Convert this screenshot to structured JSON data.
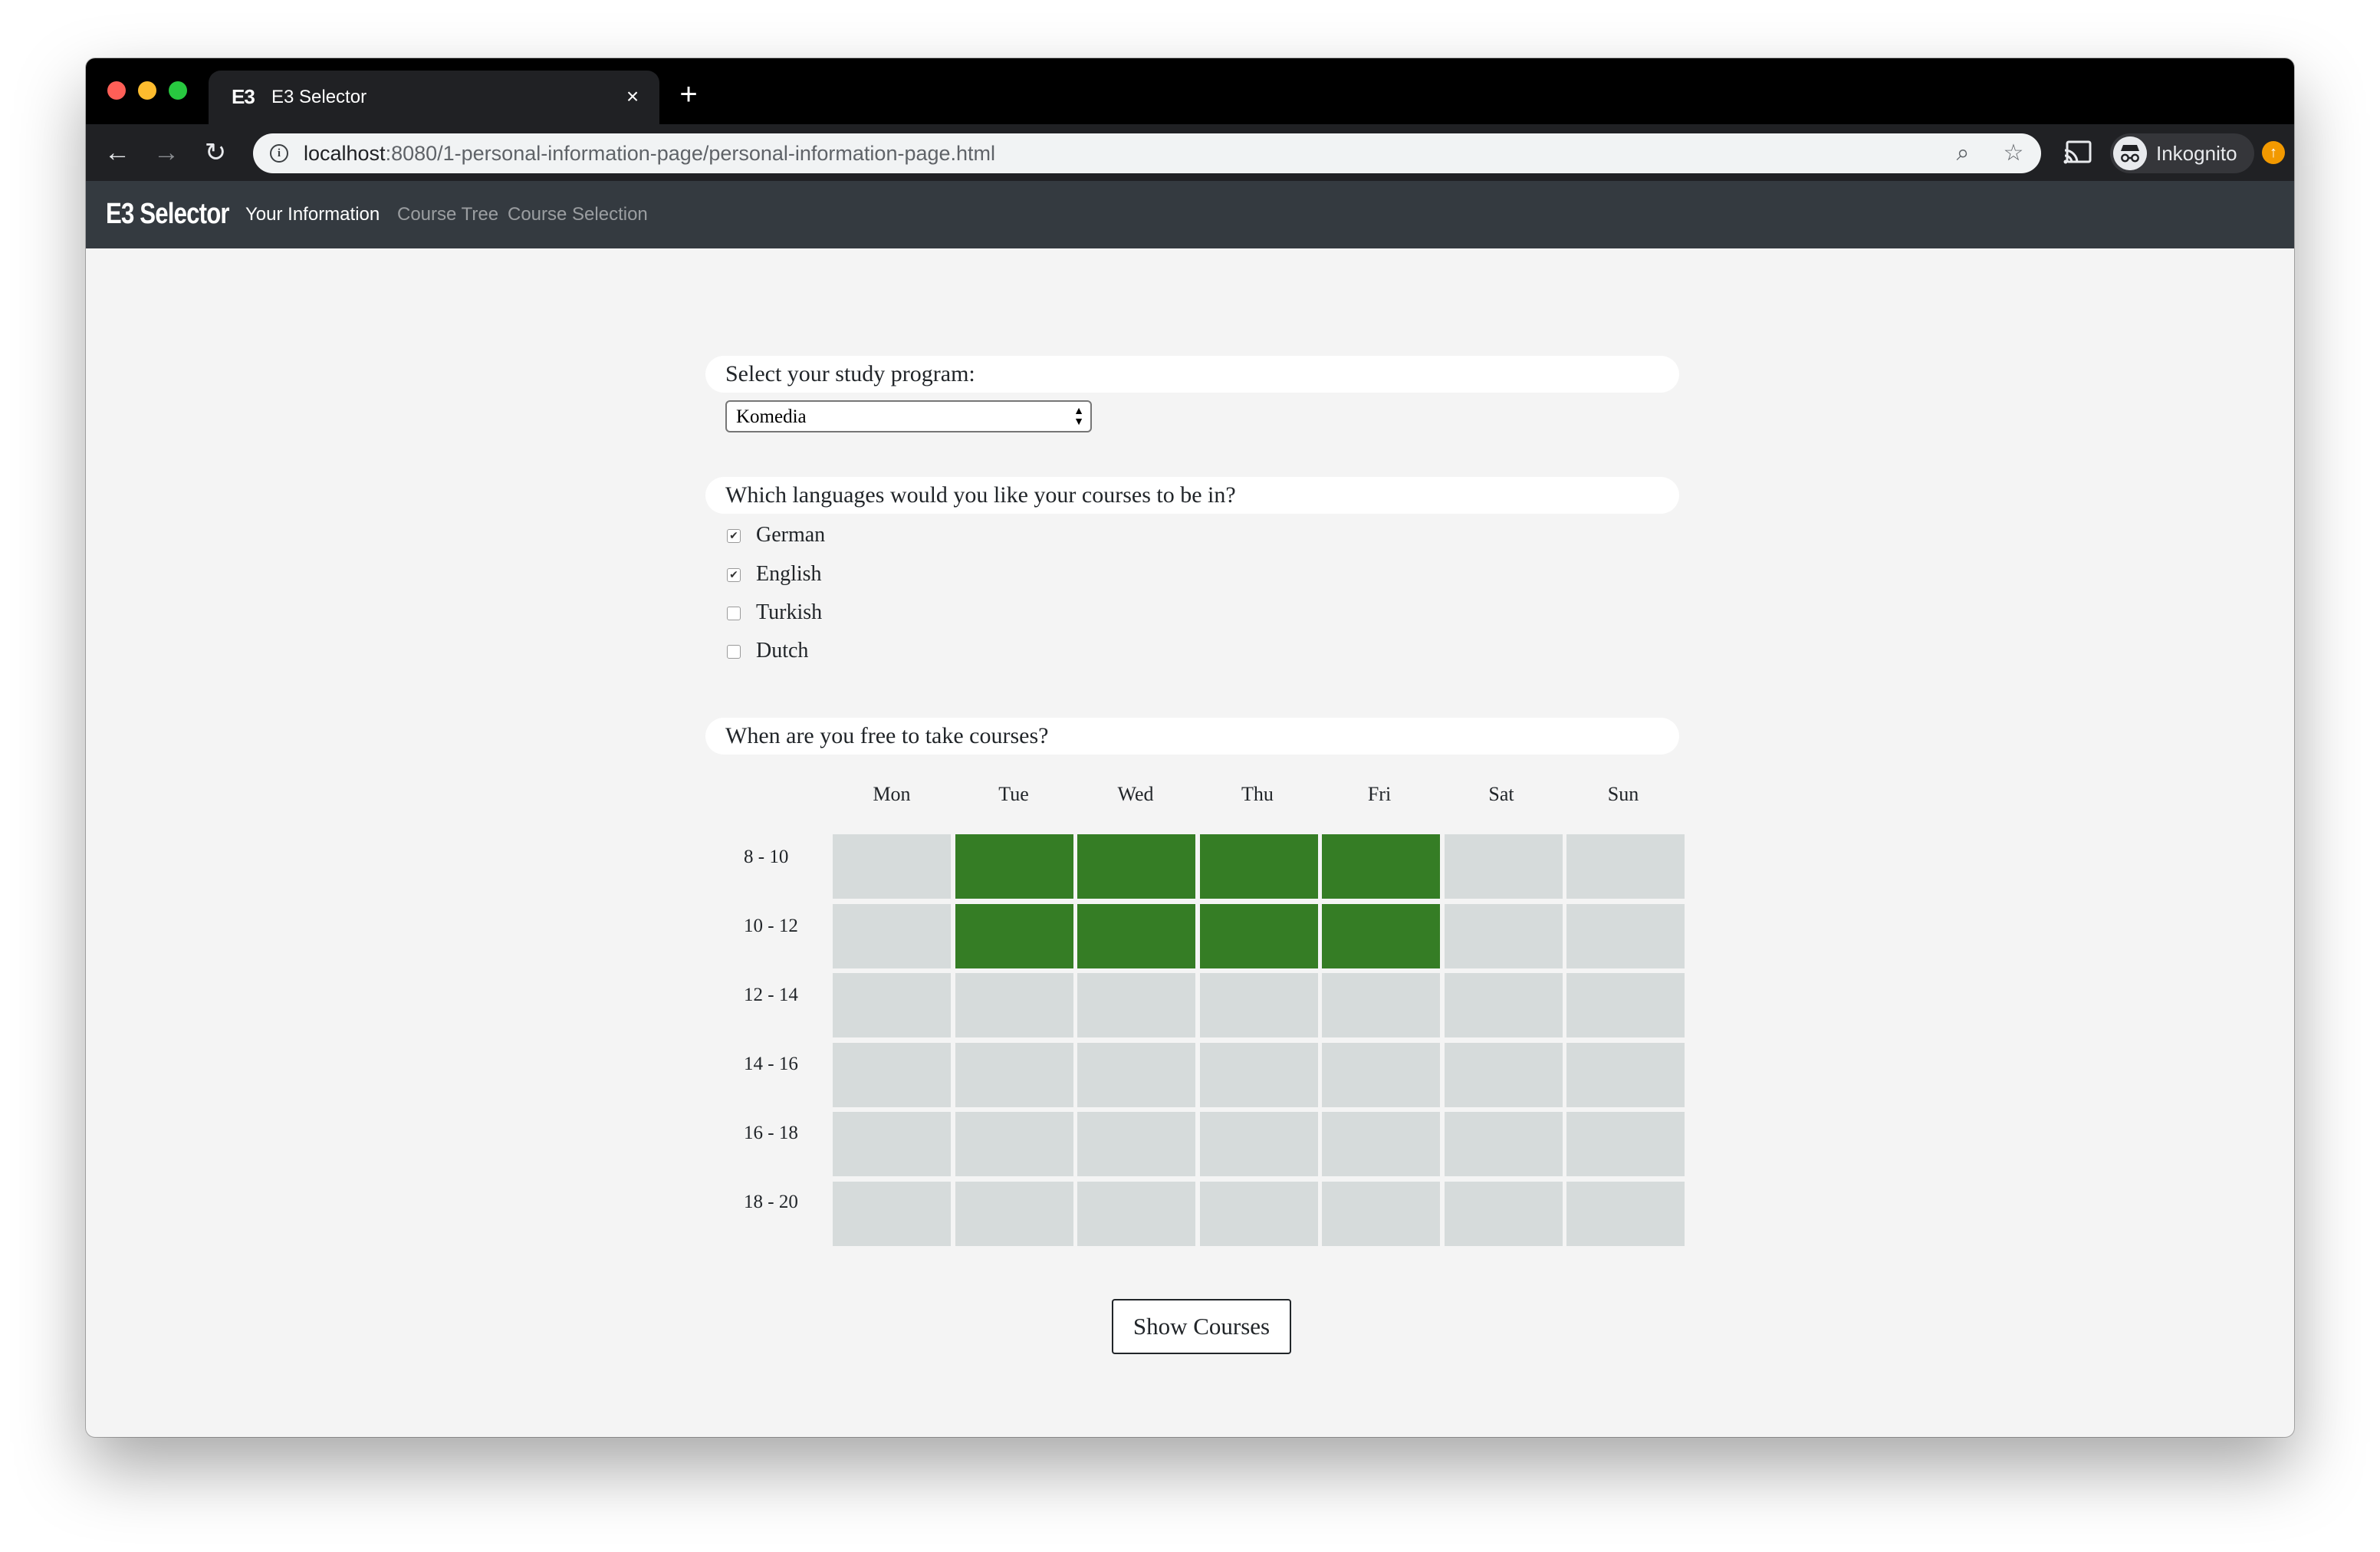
{
  "browser": {
    "tab_title": "E3 Selector",
    "tab_favicon": "E3",
    "new_tab": "+",
    "tab_close": "×",
    "url_host": "localhost",
    "url_rest": ":8080/1-personal-information-page/personal-information-page.html",
    "profile": "Inkognito",
    "icons": {
      "back": "←",
      "forward": "→",
      "reload": "↻",
      "info": "i",
      "zoom": "⌕",
      "star": "☆",
      "update": "↑"
    }
  },
  "app": {
    "brand": "E3 Selector",
    "nav": [
      {
        "label": "Your Information",
        "active": true
      },
      {
        "label": "Course Tree",
        "active": false
      },
      {
        "label": "Course Selection",
        "active": false
      }
    ]
  },
  "form": {
    "program_question": "Select your study program:",
    "program_value": "Komedia",
    "languages_question": "Which languages would you like your courses to be in?",
    "languages": [
      {
        "label": "German",
        "checked": true
      },
      {
        "label": "English",
        "checked": true
      },
      {
        "label": "Turkish",
        "checked": false
      },
      {
        "label": "Dutch",
        "checked": false
      }
    ],
    "availability_question": "When are you free to take courses?",
    "days": [
      "Mon",
      "Tue",
      "Wed",
      "Thu",
      "Fri",
      "Sat",
      "Sun"
    ],
    "slots": [
      "8 - 10",
      "10 - 12",
      "12 - 14",
      "14 - 16",
      "16 - 18",
      "18 - 20"
    ],
    "availability": [
      [
        false,
        true,
        true,
        true,
        true,
        false,
        false
      ],
      [
        false,
        true,
        true,
        true,
        true,
        false,
        false
      ],
      [
        false,
        false,
        false,
        false,
        false,
        false,
        false
      ],
      [
        false,
        false,
        false,
        false,
        false,
        false,
        false
      ],
      [
        false,
        false,
        false,
        false,
        false,
        false,
        false
      ],
      [
        false,
        false,
        false,
        false,
        false,
        false,
        false
      ]
    ],
    "selected_color": "#357d25",
    "unselected_color": "#d6dbdb",
    "submit_label": "Show Courses"
  }
}
